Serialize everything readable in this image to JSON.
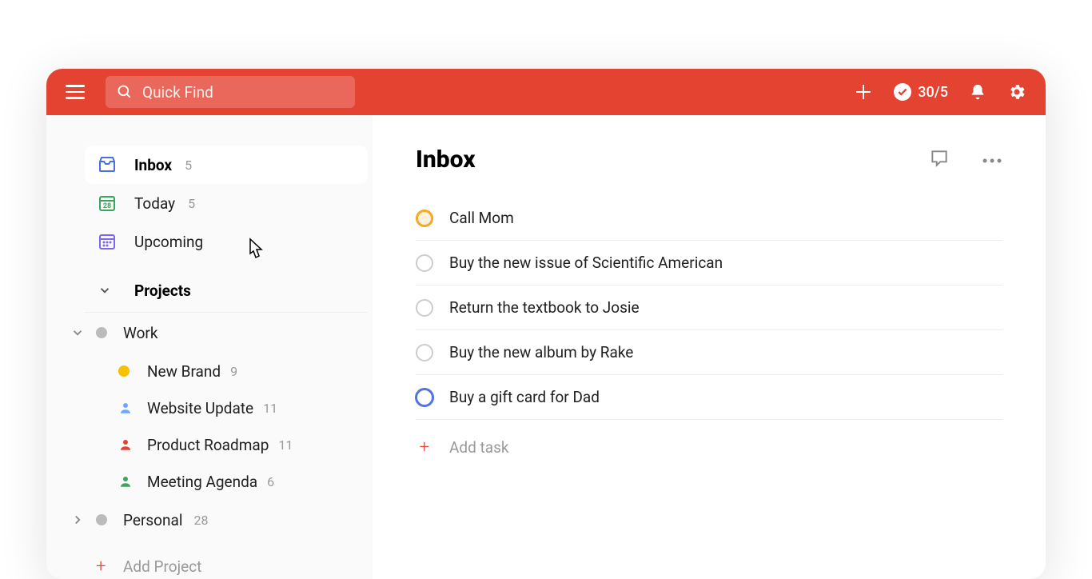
{
  "header": {
    "search_placeholder": "Quick Find",
    "productivity": "30/5"
  },
  "sidebar": {
    "nav": [
      {
        "label": "Inbox",
        "count": "5"
      },
      {
        "label": "Today",
        "count": "5"
      },
      {
        "label": "Upcoming",
        "count": ""
      }
    ],
    "projects_label": "Projects",
    "projects": [
      {
        "label": "Work",
        "count": "",
        "color": "#bbb",
        "expanded": true,
        "children": [
          {
            "label": "New Brand",
            "count": "9",
            "icon": "dot",
            "color": "#F8C100"
          },
          {
            "label": "Website Update",
            "count": "11",
            "icon": "person",
            "color": "#6EA8FE"
          },
          {
            "label": "Product Roadmap",
            "count": "11",
            "icon": "person",
            "color": "#E44332"
          },
          {
            "label": "Meeting Agenda",
            "count": "6",
            "icon": "person",
            "color": "#3BA55D"
          }
        ]
      },
      {
        "label": "Personal",
        "count": "28",
        "color": "#bbb",
        "expanded": false
      }
    ],
    "add_project_label": "Add Project"
  },
  "main": {
    "title": "Inbox",
    "tasks": [
      {
        "text": "Call Mom",
        "priority": "orange"
      },
      {
        "text": "Buy the new issue of Scientific American",
        "priority": "none"
      },
      {
        "text": "Return the textbook to Josie",
        "priority": "none"
      },
      {
        "text": "Buy the new album by Rake",
        "priority": "none"
      },
      {
        "text": "Buy a gift card for Dad",
        "priority": "blue"
      }
    ],
    "add_task_label": "Add task"
  }
}
